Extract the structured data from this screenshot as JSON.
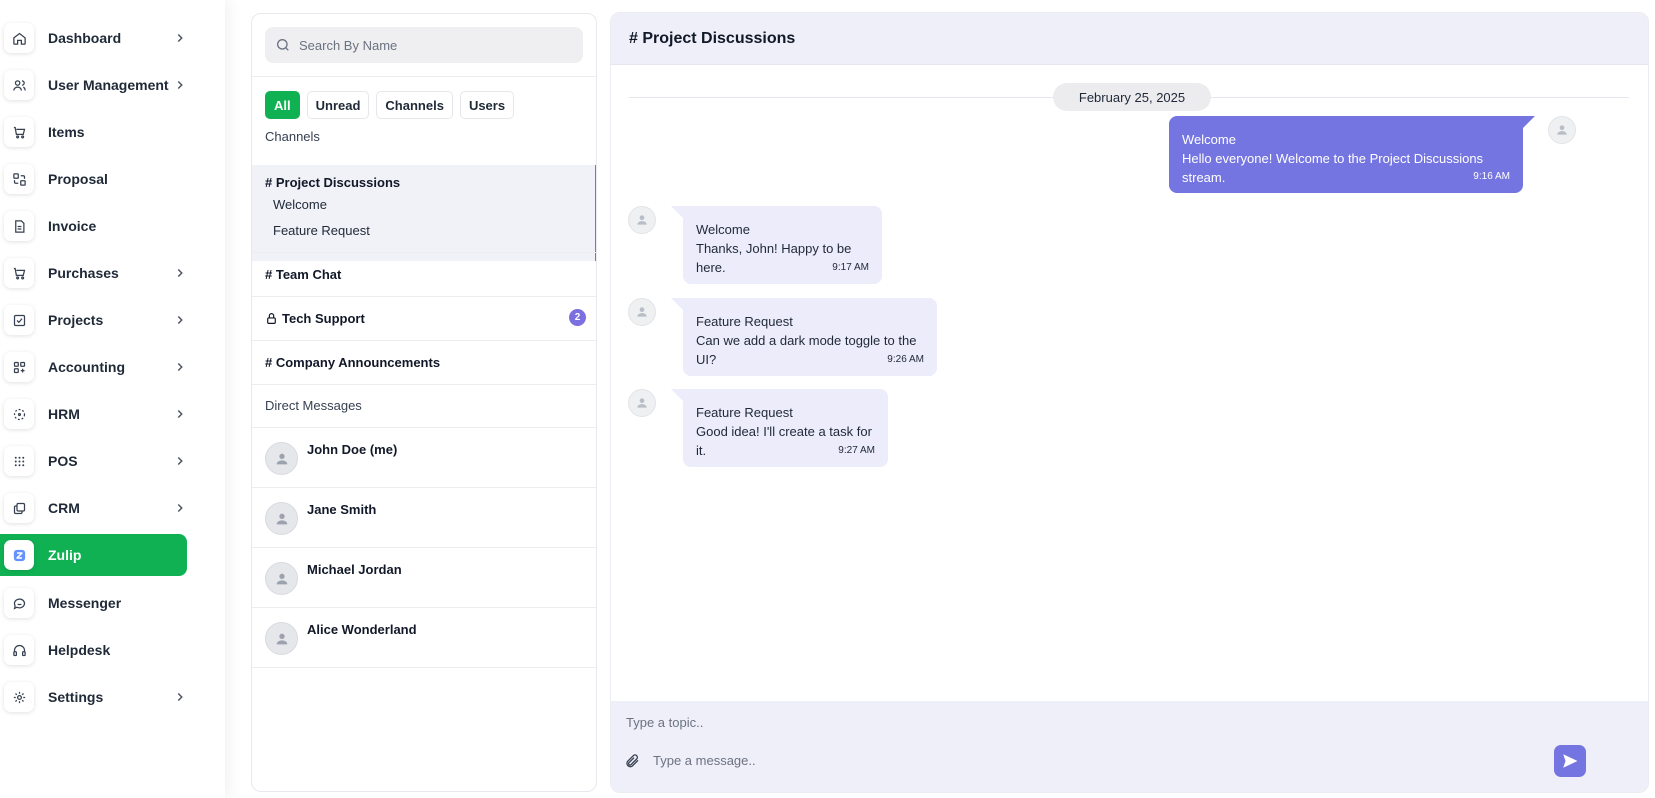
{
  "sidebar": {
    "items": [
      {
        "label": "Dashboard",
        "icon": "home-icon",
        "chevron": true
      },
      {
        "label": "User Management",
        "icon": "users-icon",
        "chevron": true
      },
      {
        "label": "Items",
        "icon": "cart-icon",
        "chevron": false
      },
      {
        "label": "Proposal",
        "icon": "proposal-icon",
        "chevron": false
      },
      {
        "label": "Invoice",
        "icon": "document-icon",
        "chevron": false
      },
      {
        "label": "Purchases",
        "icon": "cart-icon",
        "chevron": true
      },
      {
        "label": "Projects",
        "icon": "checkbox-icon",
        "chevron": true
      },
      {
        "label": "Accounting",
        "icon": "grid-plus-icon",
        "chevron": true
      },
      {
        "label": "HRM",
        "icon": "circle-dots-icon",
        "chevron": true
      },
      {
        "label": "POS",
        "icon": "dots-grid-icon",
        "chevron": true
      },
      {
        "label": "CRM",
        "icon": "layers-icon",
        "chevron": true
      },
      {
        "label": "Zulip",
        "icon": "zulip-logo-icon",
        "chevron": false,
        "active": true
      },
      {
        "label": "Messenger",
        "icon": "chat-bubble-icon",
        "chevron": false
      },
      {
        "label": "Helpdesk",
        "icon": "headset-icon",
        "chevron": false
      },
      {
        "label": "Settings",
        "icon": "gear-icon",
        "chevron": true
      }
    ],
    "accent": "#10b153"
  },
  "streams": {
    "search_placeholder": "Search By Name",
    "filters": [
      "All",
      "Unread",
      "Channels",
      "Users"
    ],
    "active_filter": "All",
    "channels_label": "Channels",
    "channels": [
      {
        "name": "# Project Discussions",
        "active": true,
        "topics": [
          "Welcome",
          "Feature Request"
        ]
      },
      {
        "name": "# Team Chat"
      },
      {
        "name": "Tech Support",
        "locked": true,
        "unread": "2"
      },
      {
        "name": "# Company Announcements"
      }
    ],
    "dm_label": "Direct Messages",
    "users": [
      "John Doe (me)",
      "Jane Smith",
      "Michael Jordan",
      "Alice Wonderland"
    ]
  },
  "chat": {
    "title": "# Project Discussions",
    "date": "February 25, 2025",
    "messages": [
      {
        "topic": "Welcome",
        "text": "Hello everyone! Welcome to the Project Discussions stream.",
        "time": "9:16 AM",
        "outgoing": true
      },
      {
        "topic": "Welcome",
        "text": "Thanks, John! Happy to be here.",
        "time": "9:17 AM",
        "outgoing": false
      },
      {
        "topic": "Feature Request",
        "text": "Can we add a dark mode toggle to the UI?",
        "time": "9:26 AM",
        "outgoing": false
      },
      {
        "topic": "Feature Request",
        "text": "Good idea! I'll create a task for it.",
        "time": "9:27 AM",
        "outgoing": false
      }
    ],
    "topic_placeholder": "Type a topic..",
    "message_placeholder": "Type a message..",
    "accent": "#7475e0"
  }
}
